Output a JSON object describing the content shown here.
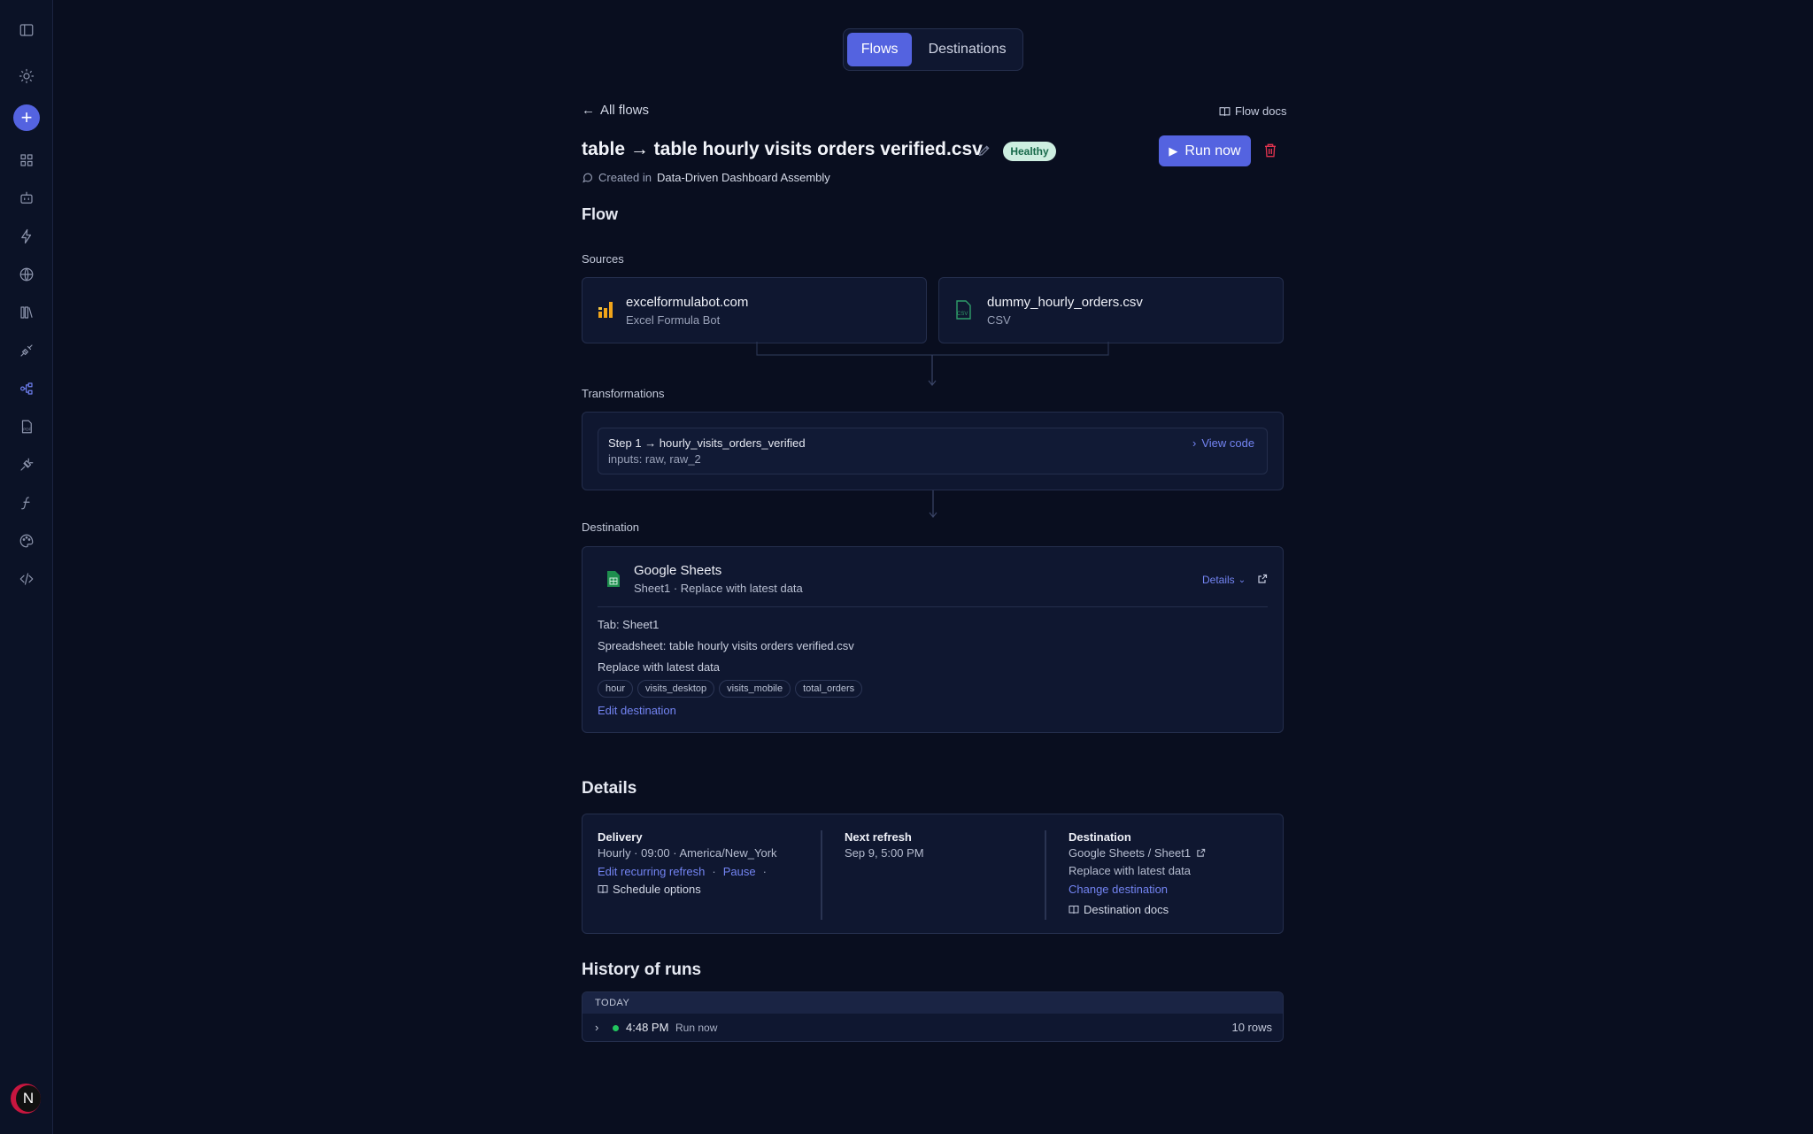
{
  "tabs": {
    "flows": "Flows",
    "destinations": "Destinations"
  },
  "nav": {
    "back": "All flows",
    "docs": "Flow docs"
  },
  "flow": {
    "title": "table → table hourly visits orders verified.csv",
    "status": "Healthy",
    "run_label": "Run now",
    "created_prefix": "Created in",
    "created_project": "Data-Driven Dashboard Assembly"
  },
  "section_flow": "Flow",
  "sources": {
    "label": "Sources",
    "items": [
      {
        "name": "excelformulabot.com",
        "type": "Excel Formula Bot",
        "icon": "bar-chart-icon"
      },
      {
        "name": "dummy_hourly_orders.csv",
        "type": "CSV",
        "icon": "csv-icon"
      }
    ]
  },
  "transformations": {
    "label": "Transformations",
    "step": "Step 1 → hourly_visits_orders_verified",
    "inputs": "inputs: raw, raw_2",
    "view_code": "View code"
  },
  "destination": {
    "label": "Destination",
    "name": "Google Sheets",
    "sub": "Sheet1 · Replace with latest data",
    "details_link": "Details",
    "tab": "Tab: Sheet1",
    "spreadsheet": "Spreadsheet: table hourly visits orders verified.csv",
    "mode": "Replace with latest data",
    "columns": [
      "hour",
      "visits_desktop",
      "visits_mobile",
      "total_orders"
    ],
    "edit": "Edit destination"
  },
  "details": {
    "heading": "Details",
    "delivery": {
      "label": "Delivery",
      "value": "Hourly · 09:00 · America/New_York",
      "edit": "Edit recurring refresh",
      "pause": "Pause",
      "schedule": "Schedule options"
    },
    "next_refresh": {
      "label": "Next refresh",
      "value": "Sep 9, 5:00 PM"
    },
    "destination": {
      "label": "Destination",
      "value": "Google Sheets / Sheet1",
      "mode": "Replace with latest data",
      "change": "Change destination",
      "docs": "Destination docs"
    }
  },
  "history": {
    "heading": "History of runs",
    "group": "TODAY",
    "runs": [
      {
        "time": "4:48 PM",
        "trigger": "Run now",
        "rows": "10 rows",
        "status_color": "#22c55e"
      }
    ]
  },
  "user": {
    "initial": "N"
  },
  "colors": {
    "accent": "#5463e0",
    "bg": "#090e1f",
    "card": "#0f1730",
    "healthy": "#cdeee0"
  }
}
